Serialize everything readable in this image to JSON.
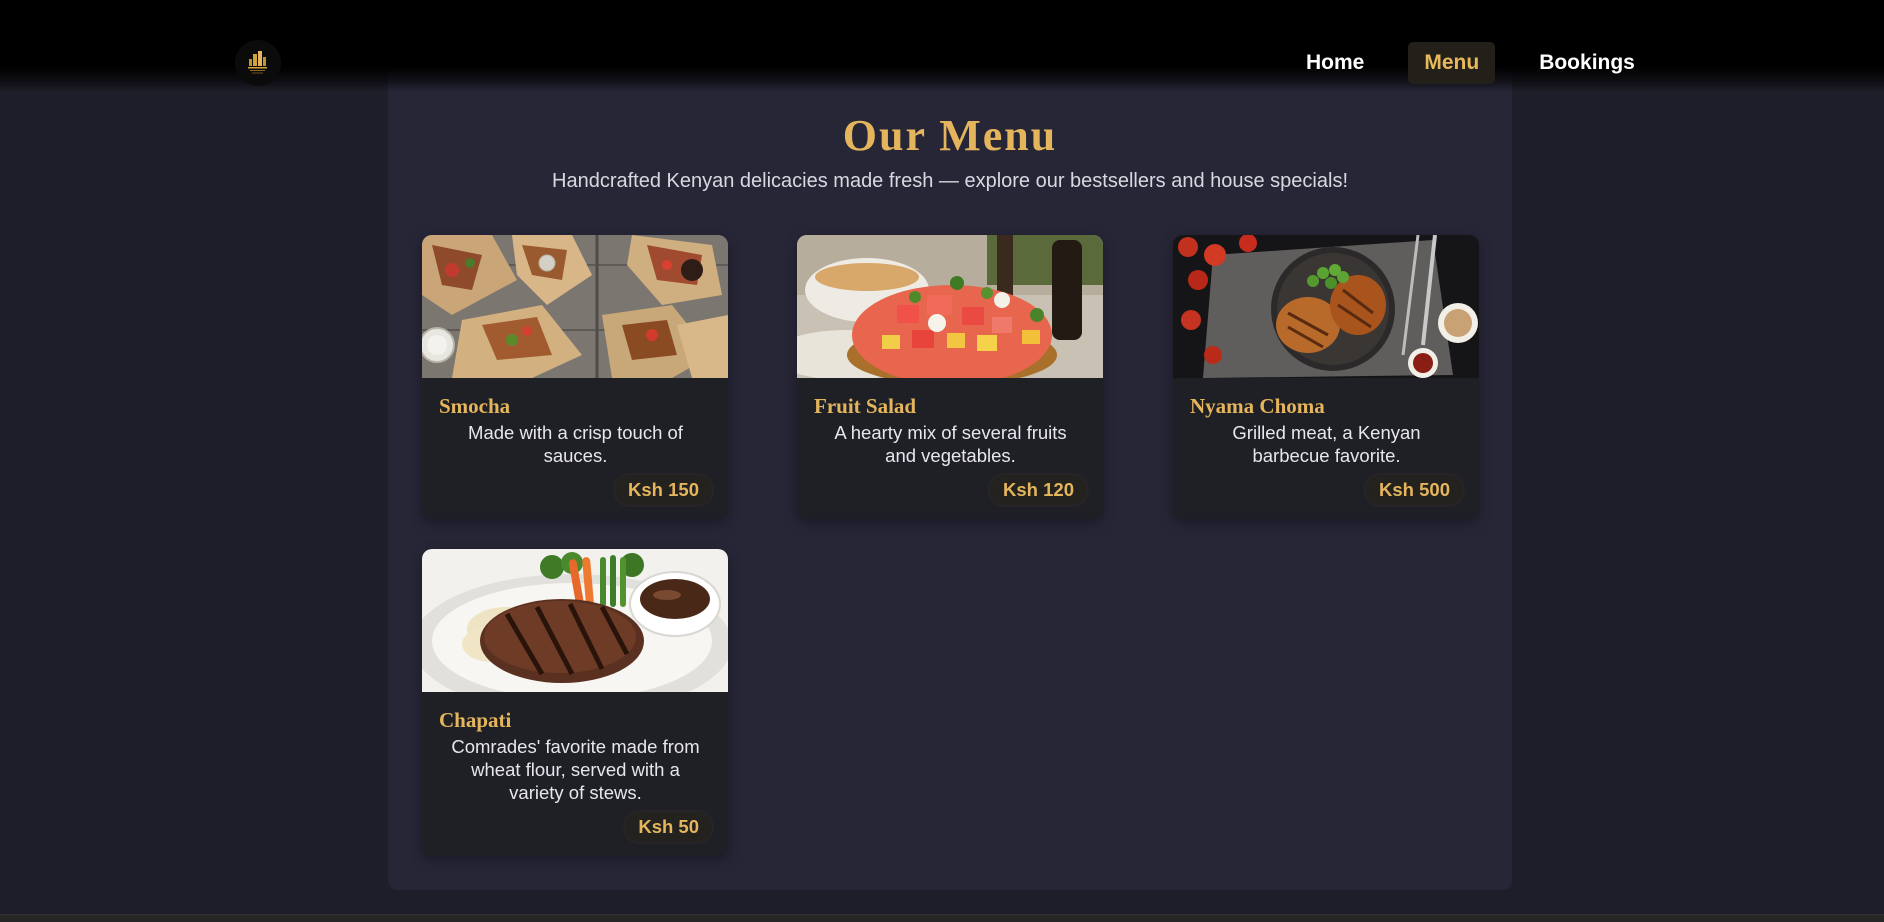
{
  "nav": {
    "logo_alt": "logo",
    "links": [
      {
        "label": "Home"
      },
      {
        "label": "Menu",
        "active": true
      },
      {
        "label": "Bookings"
      }
    ]
  },
  "menu": {
    "title": "Our Menu",
    "subtitle": "Handcrafted Kenyan delicacies made fresh — explore our bestsellers and house specials!",
    "items": [
      {
        "name": "Smocha",
        "description": "Made with a crisp touch of sauces.",
        "price": "Ksh 150",
        "image": "wraps-photo"
      },
      {
        "name": "Fruit Salad",
        "description": "A hearty mix of several fruits and vegetables.",
        "price": "Ksh 120",
        "image": "fruit-salad-photo"
      },
      {
        "name": "Nyama Choma",
        "description": "Grilled meat, a Kenyan barbecue favorite.",
        "price": "Ksh 500",
        "image": "grilled-chicken-photo"
      },
      {
        "name": "Chapati",
        "description": "Comrades' favorite made from wheat flour, served with a variety of stews.",
        "price": "Ksh 50",
        "image": "steak-plate-photo"
      }
    ]
  },
  "colors": {
    "accent": "#e4b55c",
    "page_bg": "#1e1e2a",
    "panel_bg": "#272637",
    "card_bg": "#1f1f26",
    "nav_bg": "#000000"
  }
}
